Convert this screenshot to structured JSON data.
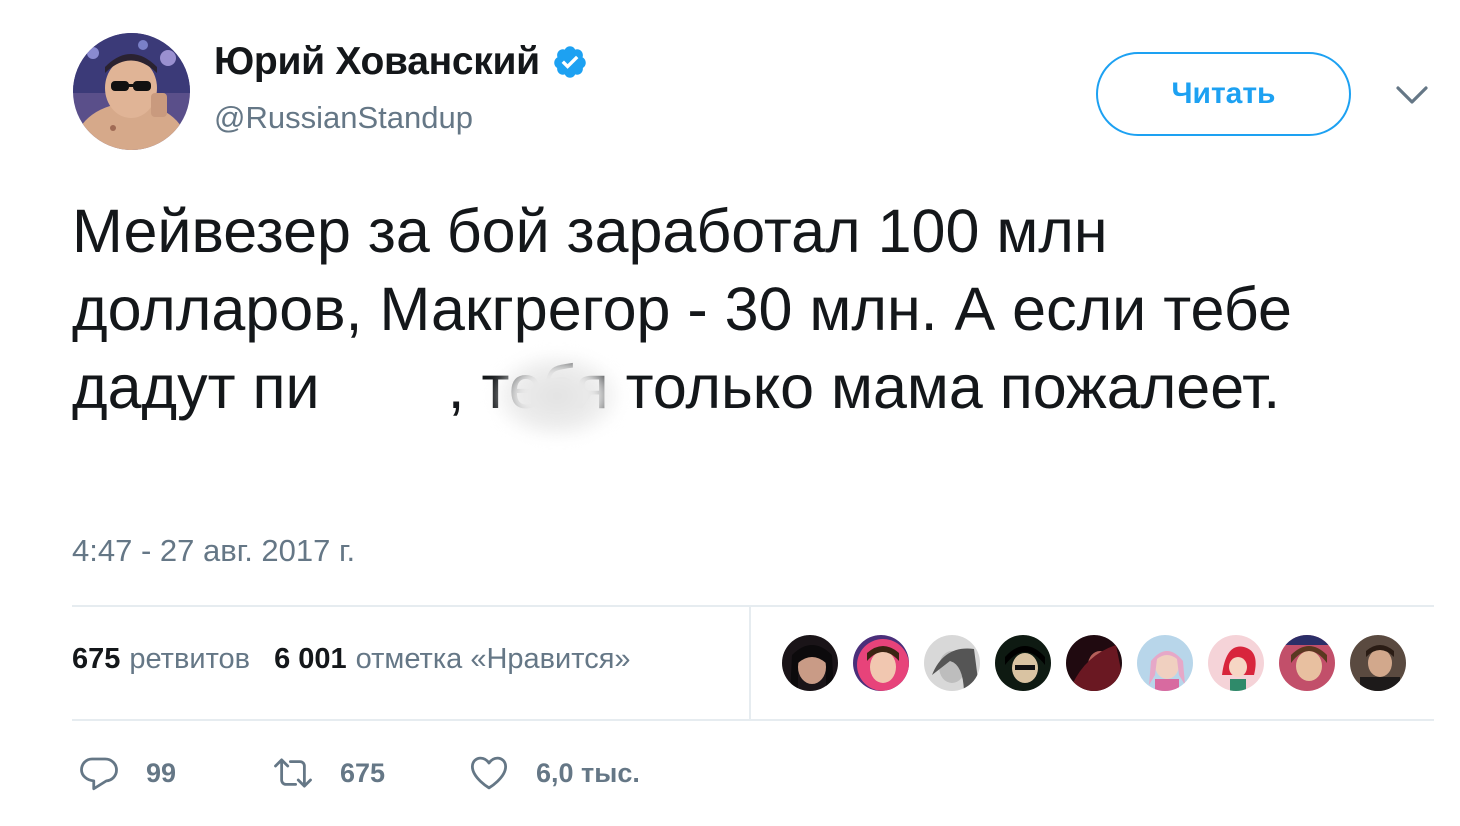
{
  "author": {
    "name": "Юрий Хованский",
    "handle": "@RussianStandup",
    "verified": true
  },
  "follow_button_label": "Читать",
  "tweet": {
    "text_before_blur": "Мейвезер за бой заработал 100 млн долларов, Макгрегор - 30 млн. А если тебе дадут пи",
    "text_after_blur": ", тебя только мама пожалеет.",
    "timestamp": "4:47 - 27 авг. 2017 г."
  },
  "stats": {
    "retweets_count": "675",
    "retweets_label": "ретвитов",
    "likes_count": "6 001",
    "likes_label": "отметка «Нравится»"
  },
  "actions": {
    "reply_count": "99",
    "retweet_count": "675",
    "like_count": "6,0 тыс."
  },
  "colors": {
    "accent": "#1da1f2",
    "secondary_text": "#657786",
    "divider": "#e6ecf0"
  },
  "likers": [
    "liker-avatar",
    "liker-avatar",
    "liker-avatar",
    "liker-avatar",
    "liker-avatar",
    "liker-avatar",
    "liker-avatar",
    "liker-avatar",
    "liker-avatar"
  ]
}
